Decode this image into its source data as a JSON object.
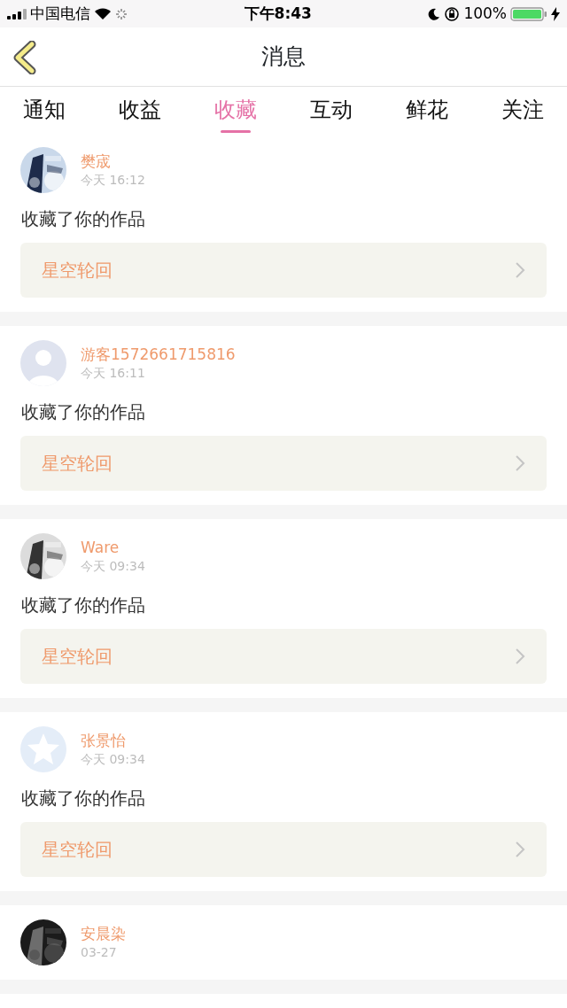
{
  "status_bar": {
    "carrier": "中国电信",
    "time": "下午8:43",
    "battery": "100%"
  },
  "header": {
    "title": "消息"
  },
  "tabs": [
    {
      "label": "通知",
      "selected": false
    },
    {
      "label": "收益",
      "selected": false
    },
    {
      "label": "收藏",
      "selected": true
    },
    {
      "label": "互动",
      "selected": false
    },
    {
      "label": "鲜花",
      "selected": false
    },
    {
      "label": "关注",
      "selected": false
    }
  ],
  "messages": [
    {
      "name": "樊宬",
      "time": "今天 16:12",
      "text": "收藏了你的作品",
      "work": "星空轮回"
    },
    {
      "avatar": {
        "kind": "default"
      },
      "name": "游客1572661715816",
      "time": "今天 16:11",
      "text": "收藏了你的作品",
      "work": "星空轮回"
    },
    {
      "name": "Ware",
      "time": "今天 09:34",
      "text": "收藏了你的作品",
      "work": "星空轮回"
    },
    {
      "avatar": {
        "kind": "star"
      },
      "name": "张景怡",
      "time": "今天 09:34",
      "text": "收藏了你的作品",
      "work": "星空轮回"
    },
    {
      "name": "安晨染",
      "time": "03-27"
    }
  ]
}
